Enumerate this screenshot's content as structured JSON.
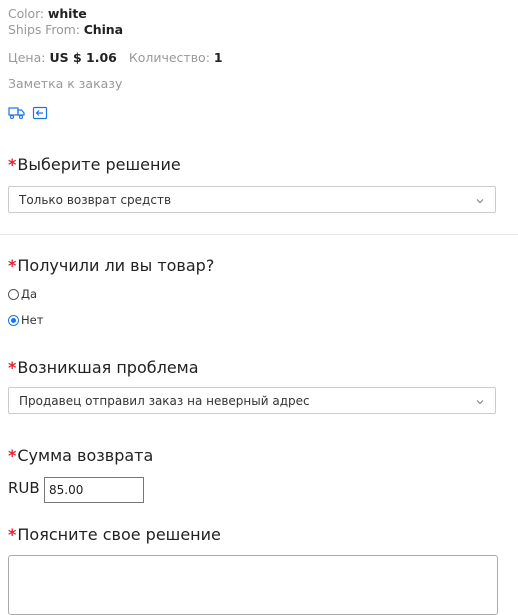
{
  "product": {
    "color_label": "Color:",
    "color_value": "white",
    "ships_label": "Ships From:",
    "ships_value": "China",
    "price_label": "Цена:",
    "price_value": "US $ 1.06",
    "qty_label": "Количество:",
    "qty_value": "1",
    "note_label": "Заметка к заказу",
    "icons": [
      "truck-icon",
      "return-icon"
    ]
  },
  "form": {
    "required_mark": "*",
    "solution": {
      "label": "Выберите решение",
      "selected": "Только возврат средств"
    },
    "received": {
      "label": "Получили ли вы товар?",
      "options": [
        {
          "label": "Да",
          "checked": false
        },
        {
          "label": "Нет",
          "checked": true
        }
      ]
    },
    "problem": {
      "label": "Возникшая проблема",
      "selected": "Продавец отправил заказ на неверный адрес"
    },
    "refund": {
      "label": "Сумма возврата",
      "currency": "RUB",
      "amount": "85.00"
    },
    "explain": {
      "label": "Поясните свое решение",
      "value": ""
    }
  },
  "colors": {
    "required": "#e4232f",
    "accent": "#1a73e8",
    "muted_text": "#999999"
  }
}
